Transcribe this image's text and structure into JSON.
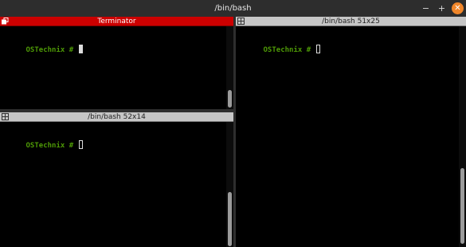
{
  "window": {
    "title": "/bin/bash",
    "controls": {
      "minimize": "−",
      "maximize": "+",
      "close": "✕"
    }
  },
  "panes": {
    "top_left": {
      "title": "Terminator",
      "prompt": "OSTechnix #",
      "active": true
    },
    "bottom_left": {
      "title": "/bin/bash 52x14",
      "prompt": "OSTechnix #",
      "active": false
    },
    "right": {
      "title": "/bin/bash 51x25",
      "prompt": "OSTechnix #",
      "active": false
    }
  },
  "colors": {
    "active_titlebar": "#cc0000",
    "inactive_titlebar": "#c6c6c6",
    "prompt": "#4e9a06",
    "close_button": "#f0862a"
  },
  "icons": {
    "pane_group": "group-icon"
  }
}
